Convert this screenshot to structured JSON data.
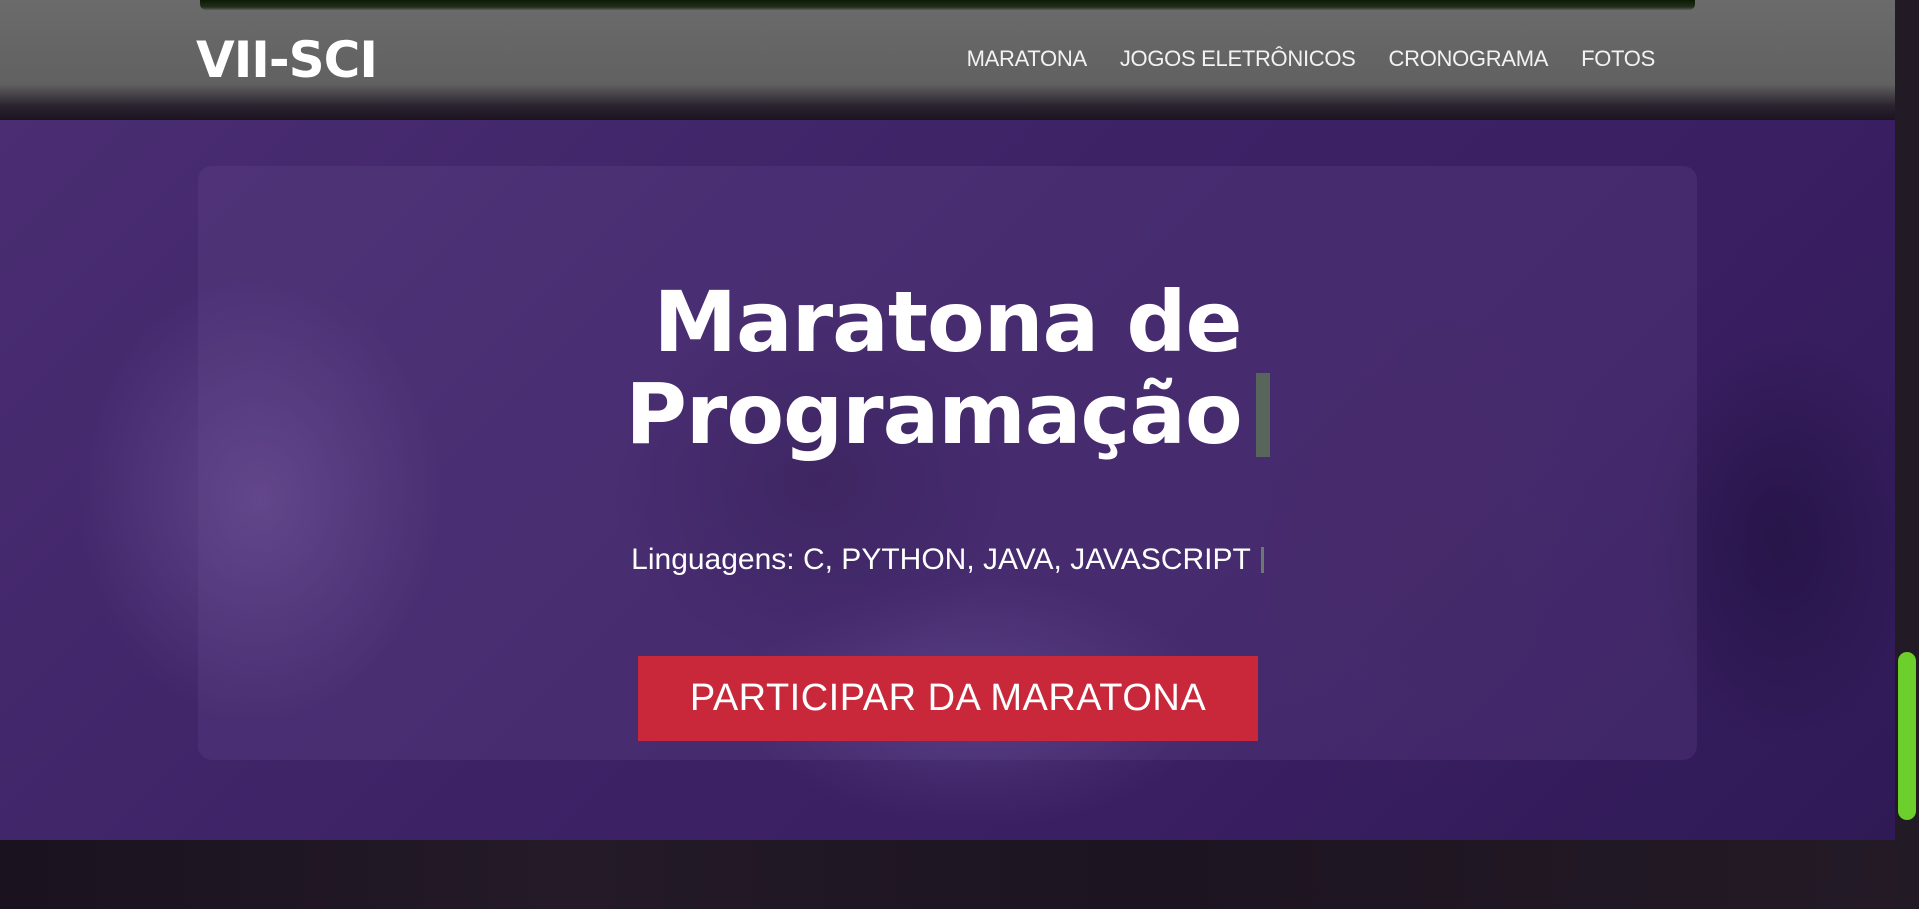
{
  "header": {
    "logo": "VII-SCI",
    "nav": [
      "MARATONA",
      "JOGOS ELETRÔNICOS",
      "CRONOGRAMA",
      "FOTOS"
    ]
  },
  "hero": {
    "title_line1": "Maratona de",
    "title_line2": "Programação",
    "subtitle": "Linguagens: C, PYTHON, JAVA, JAVASCRIPT",
    "cta_label": "PARTICIPAR DA MARATONA"
  },
  "colors": {
    "header_bg": "#616161",
    "hero_purple": "#3d2266",
    "cta_red": "#c8283a",
    "scrollbar_thumb": "#6ccf2c",
    "caret": "#57655a"
  },
  "icons": [
    "text-caret-icon"
  ]
}
